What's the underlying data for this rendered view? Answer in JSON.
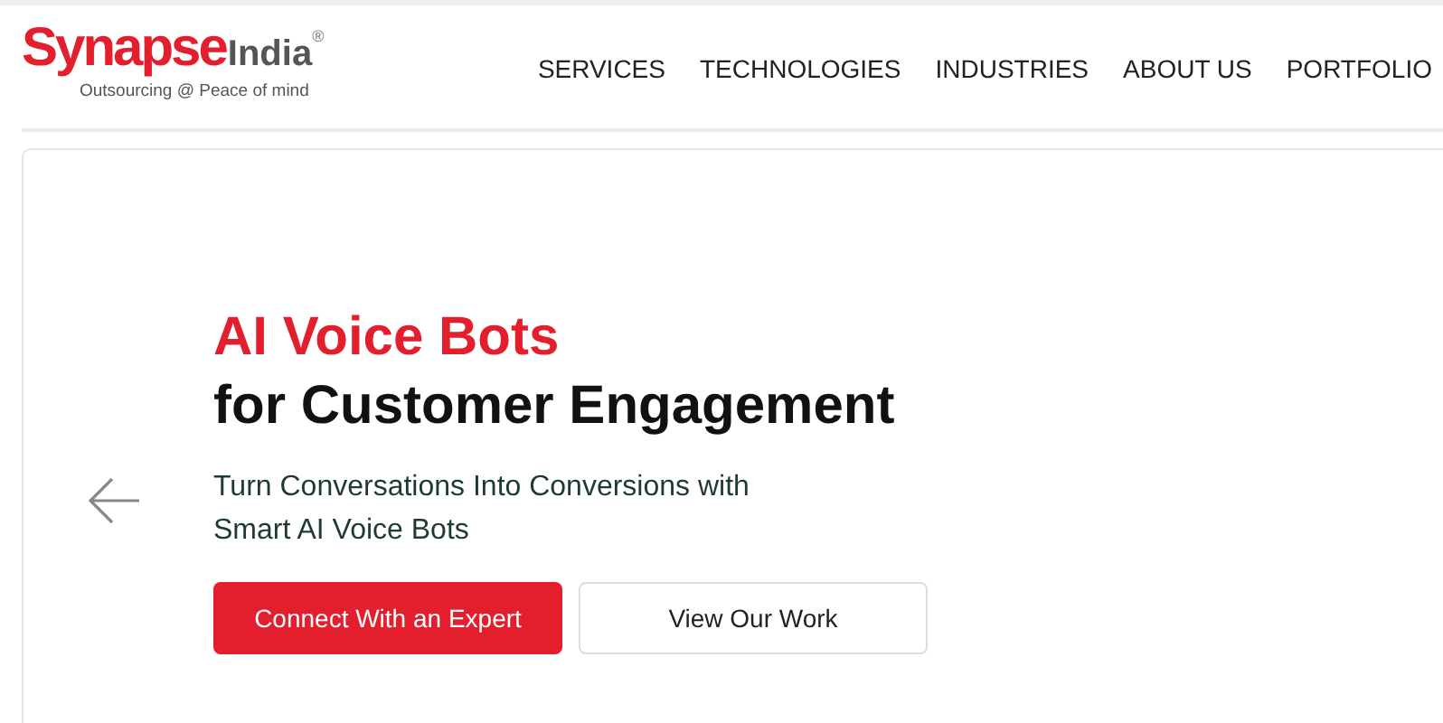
{
  "logo": {
    "brand_primary": "Synapse",
    "brand_secondary": "India",
    "registered_mark": "®",
    "tagline": "Outsourcing @ Peace of mind"
  },
  "nav": [
    {
      "label": "SERVICES"
    },
    {
      "label": "TECHNOLOGIES"
    },
    {
      "label": "INDUSTRIES"
    },
    {
      "label": "ABOUT US"
    },
    {
      "label": "PORTFOLIO"
    }
  ],
  "hero": {
    "title_highlight": "AI Voice Bots",
    "title": "for Customer Engagement",
    "subtitle": "Turn Conversations Into Conversions with Smart AI Voice Bots",
    "buttons": [
      {
        "label": "Connect With an Expert",
        "kind": "primary"
      },
      {
        "label": "View Our Work",
        "kind": "secondary"
      }
    ]
  }
}
